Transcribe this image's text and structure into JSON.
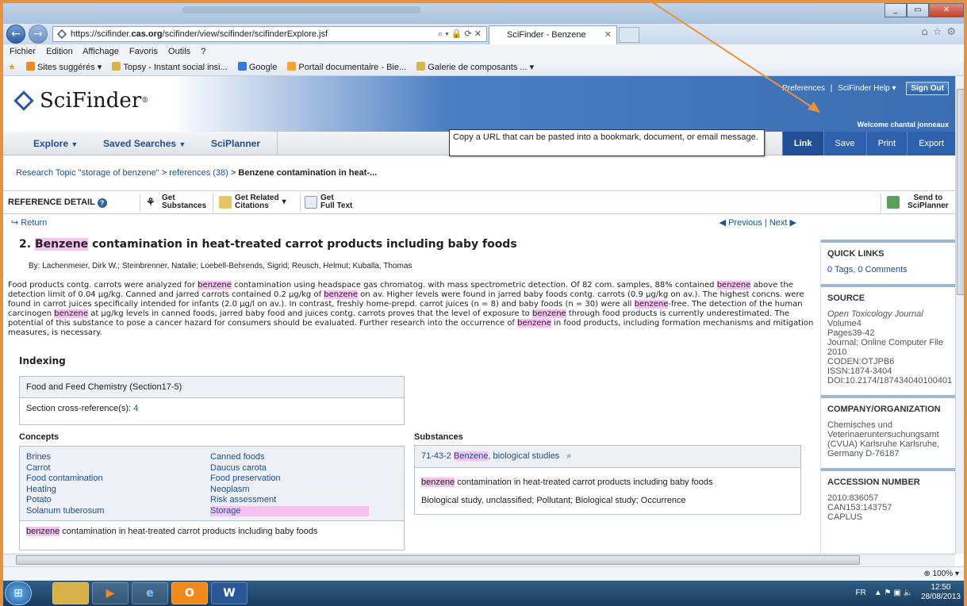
{
  "browser": {
    "url_prefix": "https://scifinder.",
    "url_domain": "cas.org",
    "url_path": "/scifinder/view/scifinder/scifinderExplore.jsf",
    "tab_title": "SciFinder - Benzene conta...",
    "menu": [
      "Fichier",
      "Edition",
      "Affichage",
      "Favoris",
      "Outils",
      "?"
    ],
    "favorites": [
      "Sites suggérés ▾",
      "Topsy - Instant social insi...",
      "Google",
      "Portail documentaire - Bie...",
      "Galerie de composants ... ▾"
    ],
    "zoom": "100%",
    "url_icons": "⌕ ▾ 🔒 ⟳ ✕"
  },
  "app": {
    "logo": "SciFinder",
    "logo_mark": "®",
    "preferences": "Preferences",
    "separator": "|",
    "help": "SciFinder Help ▾",
    "sign_out": "Sign Out",
    "welcome": "Welcome chantal jonneaux"
  },
  "nav": {
    "explore": "Explore",
    "saved": "Saved Searches",
    "sciplanner": "SciPlanner",
    "caret": "▼",
    "tooltip": "Copy a URL that can be pasted into a bookmark, document, or email message.",
    "link": "Link",
    "save": "Save",
    "print": "Print",
    "export": "Export"
  },
  "breadcrumb": {
    "topic": "Research Topic \"storage of benzene\"",
    "sep": ">",
    "references": "references (38)",
    "current": "Benzene contamination in heat-..."
  },
  "refbar": {
    "title": "REFERENCE DETAIL",
    "get_substances_1": "Get",
    "get_substances_2": "Substances",
    "get_related_1": "Get Related",
    "get_related_2": "Citations",
    "get_fulltext_1": "Get",
    "get_fulltext_2": "Full Text",
    "send_1": "Send to",
    "send_2": "SciPlanner",
    "return": "Return",
    "previous": "Previous",
    "next": "Next"
  },
  "reference": {
    "number": "2.",
    "title_hl": "Benzene",
    "title_rest": "contamination in heat-treated carrot products including baby foods",
    "authors": "By: Lachenmeier, Dirk W.; Steinbrenner, Natalie; Loebell-Behrends, Sigrid; Reusch, Helmut; Kuballa, Thomas",
    "abstract": [
      [
        "Food products contg. carrots were analyzed for ",
        "benzene",
        " contamination using headspace gas chromatog. with mass spectrometric detection.  Of 82 com. samples, 88% contained ",
        "benzene",
        " above the detection limit of 0.04 µg/kg.  Canned and jarred carrots contained 0.2 µg/kg of ",
        "benzene",
        " on av.  Higher levels were found in jarred baby foods contg. carrots (0.9 µg/kg on av.).  The highest concns. were found in carrot juices specifically intended for infants (2.0 µg/l on av.).  In contrast, freshly home-prepd. carrot juices (n = 8) and baby foods (n = 30) were all ",
        "benzene",
        "-free.  The detection of the human carcinogen ",
        "benzene",
        " at µg/kg levels in canned foods, jarred baby food and juices contg. carrots proves that the level of exposure to ",
        "benzene",
        " through food products is currently underestimated.  The potential of this substance to pose a cancer hazard for consumers should be evaluated.  Further research into the occurrence of ",
        "benzene",
        " in food products, including formation mechanisms and mitigation measures, is necessary."
      ]
    ]
  },
  "indexing": {
    "heading": "Indexing",
    "section": "Food and Feed Chemistry (Section17-5)",
    "cross_ref_label": "Section cross-reference(s):",
    "cross_ref_value": "4",
    "concepts_title": "Concepts",
    "concepts": [
      "Brines",
      "Canned foods",
      "Carrot",
      "Daucus carota",
      "Food contamination",
      "Food preservation",
      "Heating",
      "Neoplasm",
      "Potato",
      "Risk assessment",
      "Solanum tuberosum",
      "Storage"
    ],
    "concepts_note_hl": "benzene",
    "concepts_note": " contamination in heat-treated carrot products including baby foods",
    "substances_title": "Substances",
    "substance_cas": "71-43-2",
    "substance_name_hl": "Benzene",
    "substance_name_rest": ", biological studies",
    "substance_note_hl": "benzene",
    "substance_note": " contamination in heat-treated carrot products including baby foods",
    "substance_roles": "Biological study, unclassified; Pollutant; Biological study; Occurrence"
  },
  "rail": {
    "quick_links": "QUICK LINKS",
    "tags": "0 Tags, 0 Comments",
    "source": "SOURCE",
    "journal": "Open Toxicology Journal",
    "source_lines": [
      "Volume4",
      "Pages39-42",
      "Journal; Online Computer File",
      "2010",
      "CODEN:OTJPB6",
      "ISSN:1874-3404",
      "DOI:10.2174/187434040100401"
    ],
    "company": "COMPANY/ORGANIZATION",
    "company_text": "Chemisches und Veterinaeruntersuchungsamt (CVUA) Karlsruhe Karlsruhe, Germany  D-76187",
    "accession": "ACCESSION NUMBER",
    "accession_lines": [
      "2010:836057",
      "CAN153:143757",
      "CAPLUS"
    ]
  },
  "taskbar": {
    "lang": "FR",
    "time": "12:50",
    "date": "28/08/2013",
    "word": "W"
  },
  "colors": {
    "accent": "#2e61ad",
    "highlight": "#f6c2f0",
    "annotation": "#e8913f"
  }
}
